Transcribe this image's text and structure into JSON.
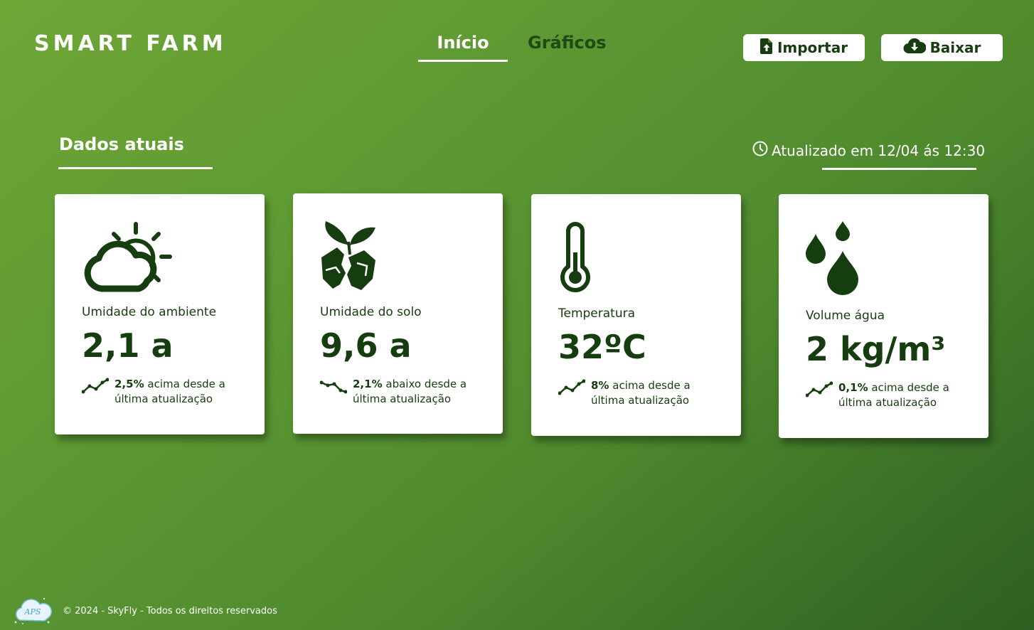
{
  "header": {
    "brand": "SMART FARM",
    "tabs": [
      {
        "label": "Início",
        "active": true
      },
      {
        "label": "Gráficos",
        "active": false
      }
    ],
    "buttons": {
      "import_label": "Importar",
      "import_icon": "file-upload-icon",
      "download_label": "Baixar",
      "download_icon": "cloud-download-icon"
    }
  },
  "section": {
    "title": "Dados atuais",
    "updated_text": "Atualizado em 12/04 ás 12:30",
    "updated_icon": "clock-icon"
  },
  "cards": [
    {
      "icon": "cloud-sun-icon",
      "label": "Umidade do ambiente",
      "value": "2,1 a",
      "change_pct": "2,5%",
      "change_text": "acima desde a",
      "change_text2": "última atualização",
      "trend": "up"
    },
    {
      "icon": "sprout-soil-icon",
      "label": "Umidade do solo",
      "value": "9,6 a",
      "change_pct": "2,1%",
      "change_text": "abaixo desde a",
      "change_text2": "última atualização",
      "trend": "down"
    },
    {
      "icon": "thermometer-icon",
      "label": "Temperatura",
      "value": "32ºC",
      "change_pct": "8%",
      "change_text": "acima desde a",
      "change_text2": "última atualização",
      "trend": "up"
    },
    {
      "icon": "water-drops-icon",
      "label": "Volume água",
      "value": "2 kg/m³",
      "change_pct": "0,1%",
      "change_text": "acima desde a",
      "change_text2": "última atualização",
      "trend": "up"
    }
  ],
  "footer": {
    "text": "© 2024 - SkyFly - Todos os direitos reservados",
    "logo_text": "APS"
  },
  "colors": {
    "dark_green": "#163d0f",
    "bg_light": "#6fa636",
    "bg_dark": "#2e5f22",
    "card_bg": "#ffffff"
  }
}
